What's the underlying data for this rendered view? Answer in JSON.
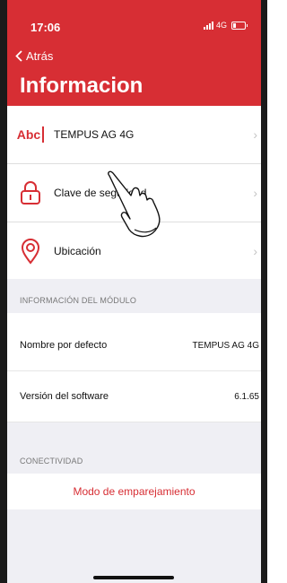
{
  "status_bar": {
    "time": "17:06",
    "network": "4G"
  },
  "nav": {
    "back_label": "Atrás",
    "title": "Informacion"
  },
  "settings": [
    {
      "icon": "abc-text-icon",
      "icon_text": "Abc",
      "label": "TEMPUS AG 4G"
    },
    {
      "icon": "lock-icon",
      "label": "Clave de seguridad"
    },
    {
      "icon": "location-pin-icon",
      "label": "Ubicación"
    }
  ],
  "module_section": {
    "header": "INFORMACIÓN DEL MÓDULO",
    "rows": [
      {
        "key": "Nombre por defecto",
        "value": "TEMPUS AG 4G"
      },
      {
        "key": "Versión del software",
        "value": "6.1.65"
      }
    ]
  },
  "connectivity_section": {
    "header": "CONECTIVIDAD",
    "pairing_label": "Modo de emparejamiento"
  },
  "colors": {
    "accent": "#d72e34",
    "group_bg": "#efeff4"
  }
}
